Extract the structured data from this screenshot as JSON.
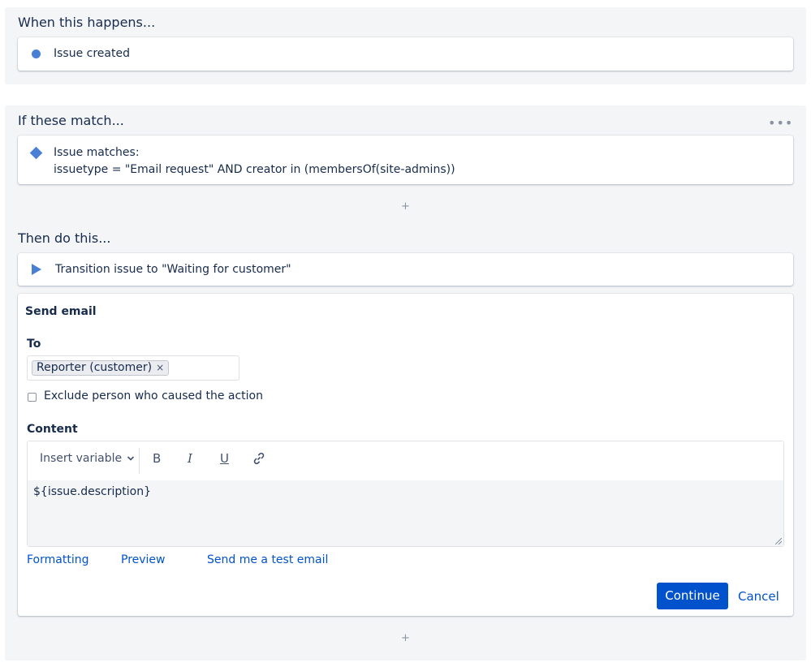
{
  "trigger": {
    "title": "When this happens...",
    "item_label": "Issue created",
    "item_icon": "dot-icon"
  },
  "condition": {
    "title": "If these match...",
    "more_label": "•••",
    "item_line1": "Issue matches:",
    "item_line2": "issuetype = \"Email request\" AND creator in (membersOf(site-admins))",
    "add_label": "+"
  },
  "actions": {
    "title": "Then do this...",
    "transition_label": "Transition issue to \"Waiting for customer\"",
    "bottom_add_label": "+"
  },
  "send_email": {
    "title": "Send email",
    "to_label": "To",
    "to_chip": "Reporter (customer)",
    "to_chip_remove": "×",
    "exclude_label": "Exclude person who caused the action",
    "exclude_checked": false,
    "content_label": "Content",
    "toolbar": {
      "insert_variable": "Insert variable",
      "bold": "B",
      "italic": "I",
      "underline": "U"
    },
    "content_value": "${issue.description}",
    "links": {
      "formatting": "Formatting",
      "preview": "Preview",
      "test_email": "Send me a test email"
    },
    "continue_label": "Continue",
    "cancel_label": "Cancel"
  },
  "colors": {
    "accent": "#0052cc",
    "icon_blue": "#4a7fd6",
    "section_bg": "#f4f5f7"
  }
}
